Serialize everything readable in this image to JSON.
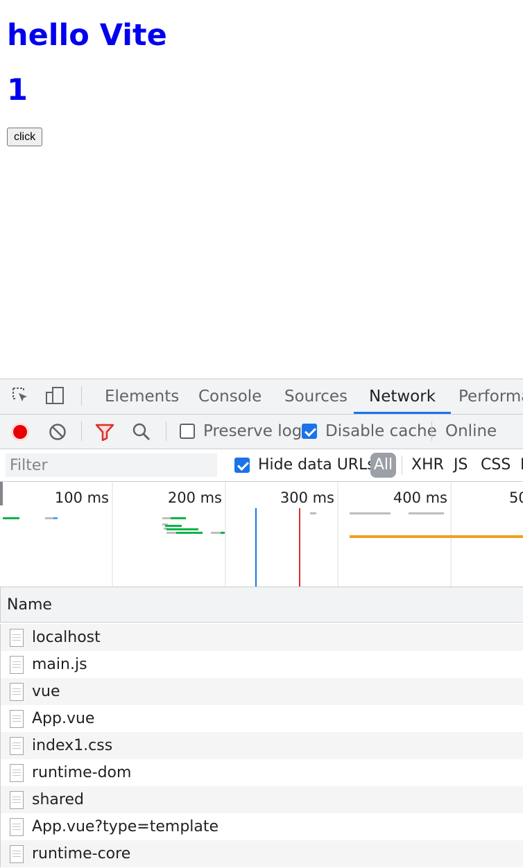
{
  "page": {
    "title": "hello Vite",
    "count": "1",
    "button_label": "click"
  },
  "devtools": {
    "tabs": [
      {
        "label": "Elements",
        "active": false
      },
      {
        "label": "Console",
        "active": false
      },
      {
        "label": "Sources",
        "active": false
      },
      {
        "label": "Network",
        "active": true
      },
      {
        "label": "Performan",
        "active": false
      }
    ],
    "toolbar": {
      "preserve_log": {
        "label": "Preserve log",
        "checked": false
      },
      "disable_cache": {
        "label": "Disable cache",
        "checked": true
      },
      "throttling": "Online"
    },
    "filterbar": {
      "placeholder": "Filter",
      "hide_data_urls": {
        "label": "Hide data URLs",
        "checked": true
      },
      "types": [
        "All",
        "XHR",
        "JS",
        "CSS",
        "I"
      ],
      "active_type": "All"
    },
    "overview": {
      "ticks": [
        "100 ms",
        "200 ms",
        "300 ms",
        "400 ms",
        "50"
      ],
      "dom_content_loaded_color": "#1a73e8",
      "load_color": "#d93025"
    },
    "table": {
      "header": "Name",
      "rows": [
        "localhost",
        "main.js",
        "vue",
        "App.vue",
        "index1.css",
        "runtime-dom",
        "shared",
        "App.vue?type=template",
        "runtime-core"
      ]
    },
    "icons": [
      "inspect-element-icon",
      "device-toolbar-icon",
      "record-icon",
      "clear-icon",
      "filter-icon",
      "search-icon",
      "file-icon"
    ],
    "colors": {
      "accent": "#1a73e8",
      "record": "#ea0000",
      "filter_active": "#d93025"
    }
  }
}
